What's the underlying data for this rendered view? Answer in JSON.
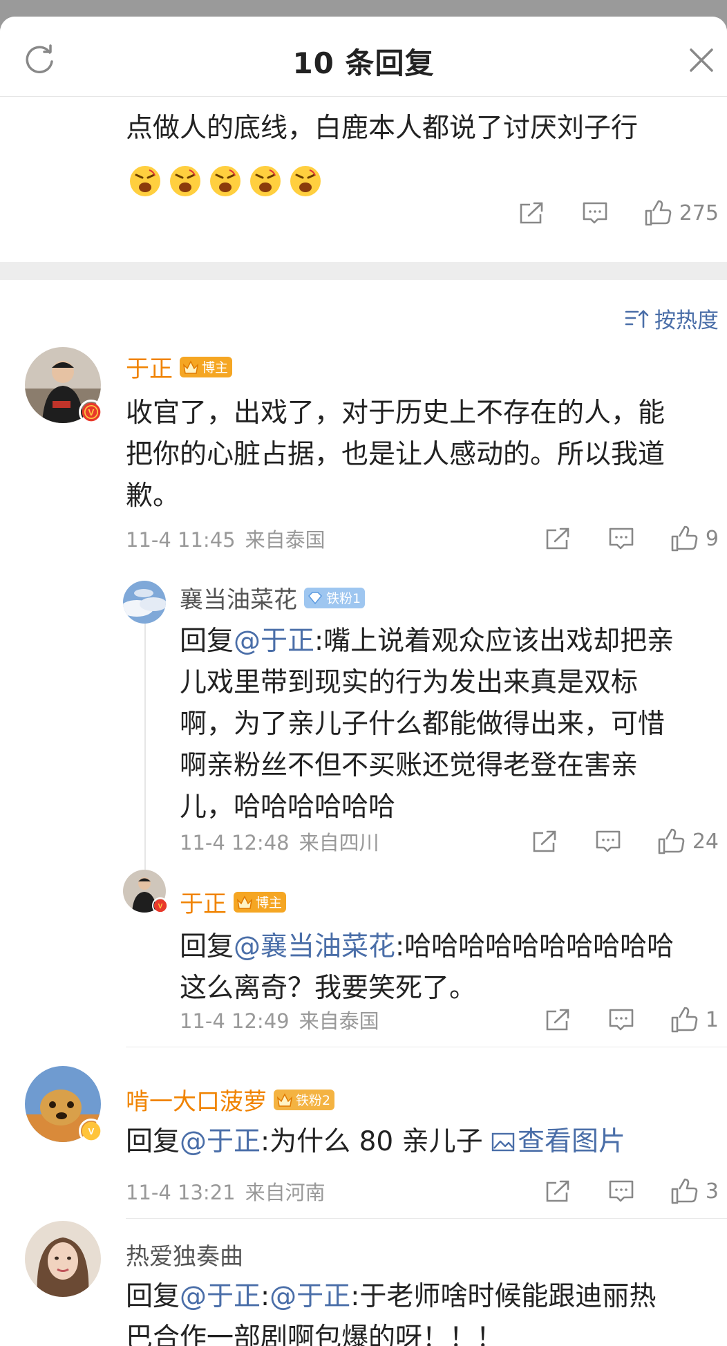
{
  "header": {
    "title": "10 条回复"
  },
  "previous": {
    "text": "点做人的底线，白鹿本人都说了讨厌刘子行",
    "emoji_count": 5,
    "like_count": "275"
  },
  "sort": {
    "label": "按热度"
  },
  "comments": [
    {
      "name": "于正",
      "badge": "博主",
      "text": "收官了，出戏了，对于历史上不存在的人，能把你的心脏占据，也是让人感动的。所以我道歉。",
      "line1": "收官了，出戏了，对于历史上不存在的人，能",
      "line2": "把你的心脏占据，也是让人感动的。所以我道",
      "line3": "歉。",
      "time": "11-4 11:45",
      "source": "来自泰国",
      "likes": "9"
    },
    {
      "name": "襄当油菜花",
      "badge": "铁粉1",
      "reply_prefix": "回复",
      "mention": "@于正",
      "line1": ":嘴上说着观众应该出戏却把亲",
      "line2": "儿戏里带到现实的行为发出来真是双标",
      "line3": "啊，为了亲儿子什么都能做得出来，可惜",
      "line4": "啊亲粉丝不但不买账还觉得老登在害亲",
      "line5": "儿，哈哈哈哈哈哈",
      "time": "11-4 12:48",
      "source": "来自四川",
      "likes": "24"
    },
    {
      "name": "于正",
      "badge": "博主",
      "reply_prefix": "回复",
      "mention": "@襄当油菜花",
      "line1": ":哈哈哈哈哈哈哈哈哈哈",
      "line2": "这么离奇？我要笑死了。",
      "time": "11-4 12:49",
      "source": "来自泰国",
      "likes": "1"
    },
    {
      "name": "啃一大口菠萝",
      "badge": "铁粉2",
      "reply_prefix": "回复",
      "mention": "@于正",
      "line1": ":为什么 80 亲儿子 ",
      "image_link": "查看图片",
      "time": "11-4 13:21",
      "source": "来自河南",
      "likes": "3"
    },
    {
      "name": "热爱独奏曲",
      "reply_prefix": "回复",
      "mention": "@于正",
      "mention2": "@于正",
      "line1": ":于老师啥时候能跟迪丽热",
      "line2": "巴合作一部剧啊包爆的呀！！！"
    }
  ],
  "colors": {
    "link": "#4a6ea8",
    "name_orange": "#f08300",
    "meta_gray": "#999999"
  },
  "icons": [
    "refresh-icon",
    "close-icon",
    "share-icon",
    "comment-icon",
    "like-icon",
    "sort-icon",
    "image-icon",
    "crown-icon",
    "verified-icon"
  ]
}
